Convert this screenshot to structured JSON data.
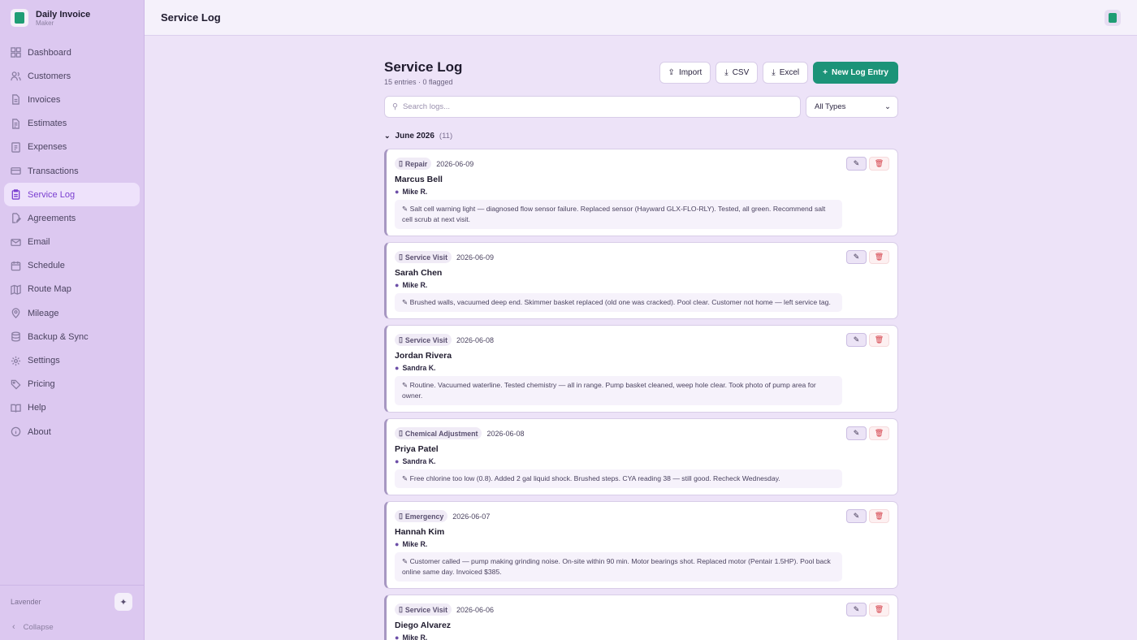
{
  "brand": {
    "title": "Daily Invoice",
    "subtitle": "Maker"
  },
  "topbar": {
    "title": "Service Log"
  },
  "sidebar": {
    "items": [
      {
        "label": "Dashboard",
        "icon": "grid-icon"
      },
      {
        "label": "Customers",
        "icon": "users-icon"
      },
      {
        "label": "Invoices",
        "icon": "file-icon"
      },
      {
        "label": "Estimates",
        "icon": "file-text-icon"
      },
      {
        "label": "Expenses",
        "icon": "receipt-icon"
      },
      {
        "label": "Transactions",
        "icon": "card-icon"
      },
      {
        "label": "Service Log",
        "icon": "clipboard-icon",
        "active": true
      },
      {
        "label": "Agreements",
        "icon": "file-pen-icon"
      },
      {
        "label": "Email",
        "icon": "mail-icon"
      },
      {
        "label": "Schedule",
        "icon": "calendar-icon"
      },
      {
        "label": "Route Map",
        "icon": "map-icon"
      },
      {
        "label": "Mileage",
        "icon": "pin-icon"
      },
      {
        "label": "Backup & Sync",
        "icon": "database-icon"
      },
      {
        "label": "Settings",
        "icon": "gear-icon"
      },
      {
        "label": "Pricing",
        "icon": "tag-icon"
      },
      {
        "label": "Help",
        "icon": "book-icon"
      },
      {
        "label": "About",
        "icon": "info-icon"
      }
    ],
    "theme_label": "Lavender",
    "collapse_label": "Collapse"
  },
  "main": {
    "title": "Service Log",
    "subtitle": "15 entries · 0 flagged",
    "buttons": {
      "import": "Import",
      "csv": "CSV",
      "excel": "Excel",
      "new": "New Log Entry"
    },
    "search": {
      "placeholder": "Search logs..."
    },
    "filter": {
      "value": "All Types"
    },
    "group": {
      "label": "June 2026",
      "count": "(11)"
    },
    "entries": [
      {
        "type": "Repair",
        "date": "2026-06-09",
        "customer": "Marcus Bell",
        "tech": "Mike R.",
        "note": "Salt cell warning light — diagnosed flow sensor failure. Replaced sensor (Hayward GLX-FLO-RLY). Tested, all green. Recommend salt cell scrub at next visit."
      },
      {
        "type": "Service Visit",
        "date": "2026-06-09",
        "customer": "Sarah Chen",
        "tech": "Mike R.",
        "note": "Brushed walls, vacuumed deep end. Skimmer basket replaced (old one was cracked). Pool clear. Customer not home — left service tag."
      },
      {
        "type": "Service Visit",
        "date": "2026-06-08",
        "customer": "Jordan Rivera",
        "tech": "Sandra K.",
        "note": "Routine. Vacuumed waterline. Tested chemistry — all in range. Pump basket cleaned, weep hole clear. Took photo of pump area for owner."
      },
      {
        "type": "Chemical Adjustment",
        "date": "2026-06-08",
        "customer": "Priya Patel",
        "tech": "Sandra K.",
        "note": "Free chlorine too low (0.8). Added 2 gal liquid shock. Brushed steps. CYA reading 38 — still good. Recheck Wednesday."
      },
      {
        "type": "Emergency",
        "date": "2026-06-07",
        "customer": "Hannah Kim",
        "tech": "Mike R.",
        "note": "Customer called — pump making grinding noise. On-site within 90 min. Motor bearings shot. Replaced motor (Pentair 1.5HP). Pool back online same day. Invoiced $385."
      },
      {
        "type": "Service Visit",
        "date": "2026-06-06",
        "customer": "Diego Alvarez",
        "tech": "Mike R.",
        "note": ""
      }
    ]
  }
}
